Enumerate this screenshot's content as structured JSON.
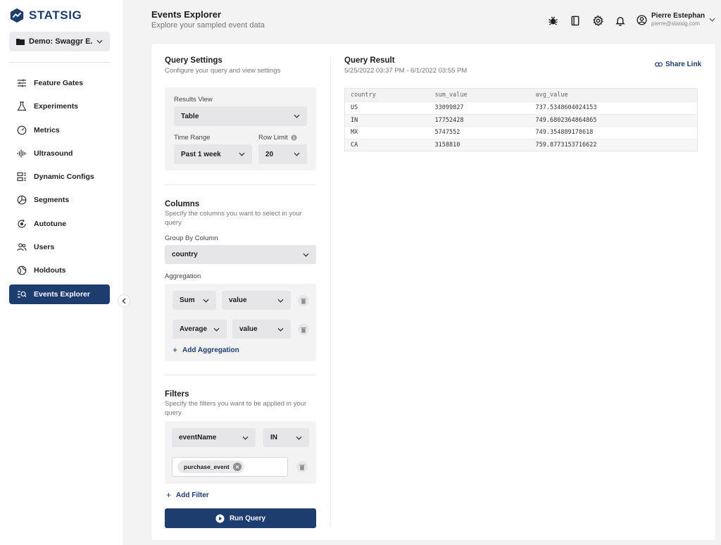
{
  "brand": {
    "name": "STATSIG",
    "color": "#1c3d6e"
  },
  "project": {
    "label": "Demo: Swaggr E..."
  },
  "nav": {
    "items": [
      {
        "label": "Feature Gates",
        "icon": "sliders-icon"
      },
      {
        "label": "Experiments",
        "icon": "flask-icon"
      },
      {
        "label": "Metrics",
        "icon": "gauge-icon"
      },
      {
        "label": "Ultrasound",
        "icon": "waveform-icon"
      },
      {
        "label": "Dynamic Configs",
        "icon": "config-icon"
      },
      {
        "label": "Segments",
        "icon": "segments-icon"
      },
      {
        "label": "Autotune",
        "icon": "autotune-icon"
      },
      {
        "label": "Users",
        "icon": "users-icon"
      },
      {
        "label": "Holdouts",
        "icon": "holdouts-icon"
      },
      {
        "label": "Events Explorer",
        "icon": "events-explorer-icon",
        "active": true
      }
    ]
  },
  "header": {
    "title": "Events Explorer",
    "subtitle": "Explore your sampled event data",
    "icons": [
      "bug-icon",
      "book-icon",
      "gear-icon",
      "bell-icon"
    ],
    "user": {
      "name": "Pierre Estephan",
      "email": "pierre@statsig.com"
    }
  },
  "query_settings": {
    "title": "Query Settings",
    "description": "Configure your query and view settings",
    "results_view": {
      "label": "Results View",
      "value": "Table"
    },
    "time_range": {
      "label": "Time Range",
      "value": "Past 1 week"
    },
    "row_limit": {
      "label": "Row Limit",
      "value": "20"
    }
  },
  "columns": {
    "title": "Columns",
    "description": "Specify the columns you want to select in your query",
    "group_by": {
      "label": "Group By Column",
      "value": "country"
    },
    "aggregation_label": "Aggregation",
    "aggregations": [
      {
        "func": "Sum",
        "column": "value"
      },
      {
        "func": "Average",
        "column": "value"
      }
    ],
    "add_aggregation": "Add Aggregation"
  },
  "filters": {
    "title": "Filters",
    "description": "Specify the filters you want to be applied in your query",
    "field": "eventName",
    "operator": "IN",
    "values": [
      "purchase_event"
    ],
    "add_filter": "Add Filter"
  },
  "run_button": "Run Query",
  "result": {
    "title": "Query Result",
    "range": "5/25/2022 03:37 PM - 6/1/2022 03:55 PM",
    "share": "Share Link",
    "columns": [
      "country",
      "sum_value",
      "avg_value"
    ],
    "rows": [
      [
        "US",
        "33099827",
        "737.5348604024153"
      ],
      [
        "IN",
        "17752428",
        "749.6802364864865"
      ],
      [
        "MX",
        "5747552",
        "749.354889178618"
      ],
      [
        "CA",
        "3158810",
        "759.8773153716622"
      ]
    ]
  }
}
